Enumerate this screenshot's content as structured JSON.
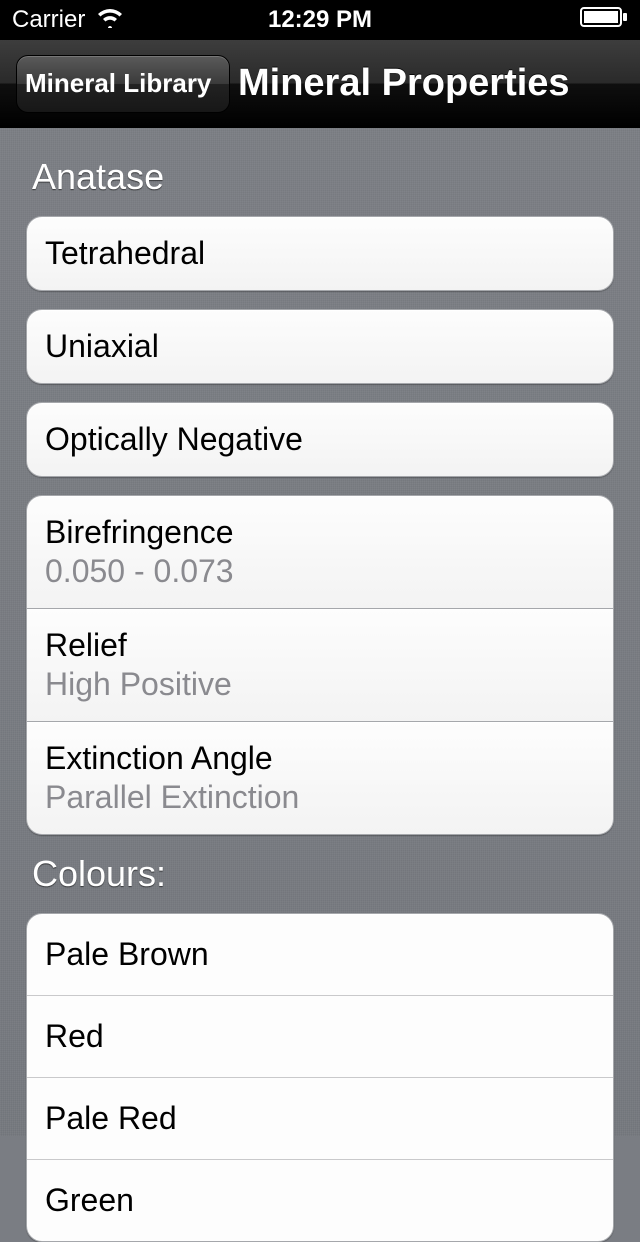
{
  "status": {
    "carrier": "Carrier",
    "time": "12:29 PM"
  },
  "nav": {
    "back_label": "Mineral Library",
    "title": "Mineral Properties"
  },
  "mineral": {
    "name": "Anatase",
    "properties": [
      {
        "label": "Tetrahedral"
      },
      {
        "label": "Uniaxial"
      },
      {
        "label": "Optically Negative"
      }
    ],
    "details": [
      {
        "label": "Birefringence",
        "value": "0.050 - 0.073"
      },
      {
        "label": "Relief",
        "value": "High Positive"
      },
      {
        "label": "Extinction Angle",
        "value": "Parallel Extinction"
      }
    ],
    "colours_header": "Colours:",
    "colours": [
      "Pale Brown",
      "Red",
      "Pale Red",
      "Green"
    ]
  }
}
